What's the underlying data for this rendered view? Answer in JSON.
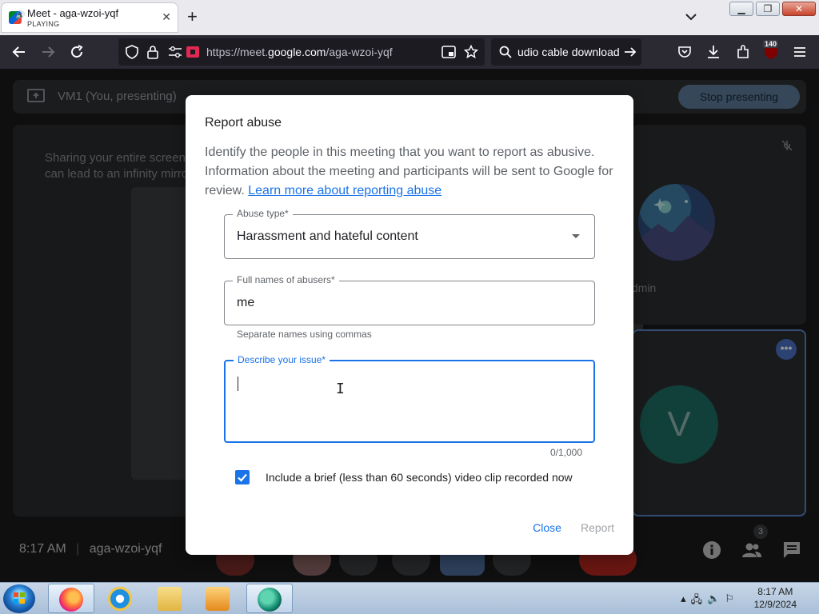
{
  "browser": {
    "tab_title": "Meet - aga-wzoi-yqf",
    "tab_subtitle": "PLAYING",
    "url_prefix": "https://meet.",
    "url_domain": "google.com",
    "url_path": "/aga-wzoi-yqf",
    "search_text": "udio cable download",
    "badge_count": "140"
  },
  "meet": {
    "presenting_label": "VM1 (You, presenting)",
    "stop_presenting_label": "Stop presenting",
    "share_warning": "Sharing your entire screen can lead to an infinity mirror",
    "tile_name": "dmin",
    "avatar_letter": "V",
    "time": "8:17 AM",
    "separator": "|",
    "meeting_code": "aga-wzoi-yqf",
    "people_count": "3"
  },
  "dialog": {
    "title": "Report abuse",
    "description": "Identify the people in this meeting that you want to report as abusive. Information about the meeting and participants will be sent to Google for review.",
    "learn_more_link": "Learn more about reporting abuse",
    "abuse_type_label": "Abuse type*",
    "abuse_type_value": "Harassment and hateful content",
    "names_label": "Full names of abusers*",
    "names_value": "me",
    "names_helper": "Separate names using commas",
    "describe_label": "Describe your issue*",
    "describe_value": "",
    "char_counter": "0/1,000",
    "include_clip_label": "Include a brief (less than 60 seconds) video clip recorded now",
    "include_clip_checked": true,
    "close_label": "Close",
    "report_label": "Report"
  },
  "taskbar": {
    "time": "8:17 AM",
    "date": "12/9/2024"
  },
  "colors": {
    "accent": "#1a73e8",
    "browser_nav": "#2b2a33",
    "meet_bg": "#202124"
  }
}
